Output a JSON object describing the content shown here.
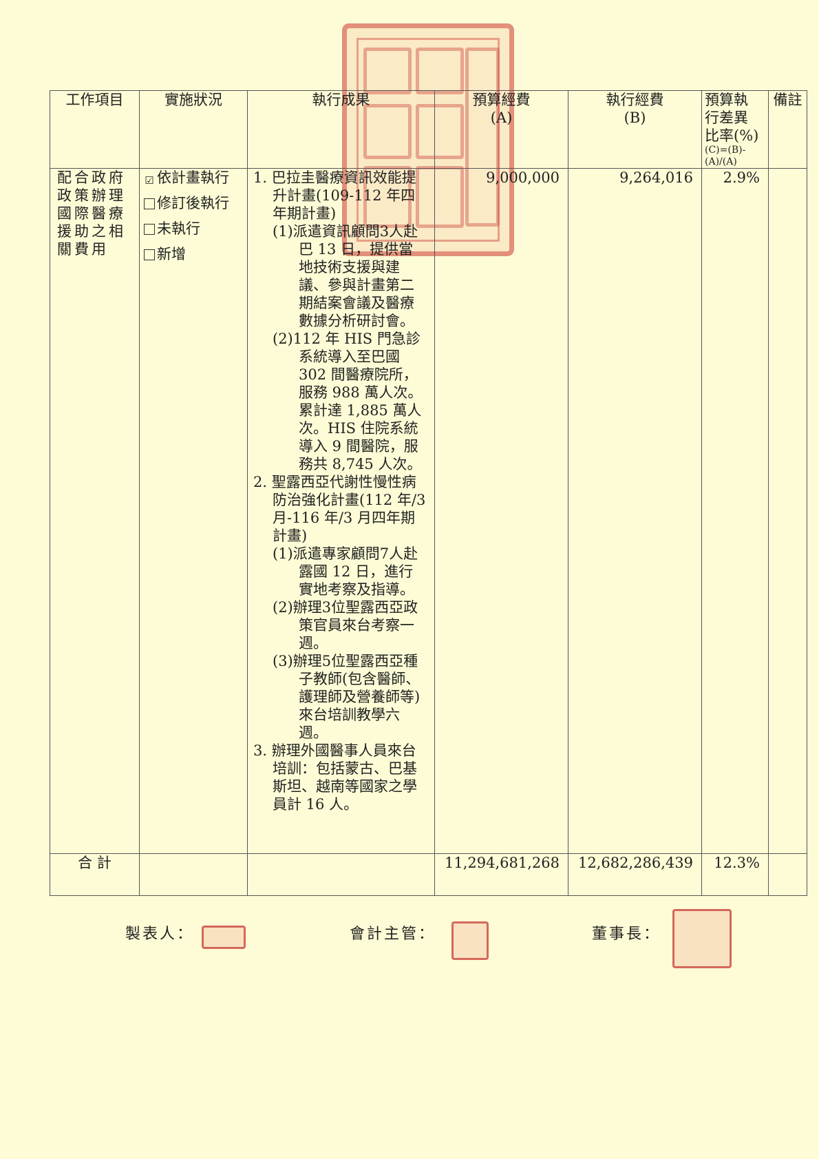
{
  "header": {
    "item": "工作項目",
    "status": "實施狀況",
    "result": "執行成果",
    "budget": "預算經費",
    "budget_sub": "(A)",
    "exec": "執行經費",
    "exec_sub": "(B)",
    "diff_1": "預算執",
    "diff_2": "行差異",
    "diff_3": "比率(%)",
    "diff_4": "(C)=(B)-",
    "diff_5": "(A)/(A)",
    "remarks": "備註"
  },
  "row": {
    "item_lines": [
      "配合政府",
      "政策辦理",
      "國際醫療",
      "援助之相",
      "關費用"
    ],
    "status": [
      {
        "checked": true,
        "label": "依計畫執行"
      },
      {
        "checked": false,
        "label": "修訂後執行"
      },
      {
        "checked": false,
        "label": "未執行"
      },
      {
        "checked": false,
        "label": "新增"
      }
    ],
    "check_mark": "☑",
    "r1": "1. 巴拉圭醫療資訊效能提升計畫(109-112 年四年期計畫)",
    "r1_1": "(1)派遣資訊顧問3人赴巴 13 日，提供當地技術支援與建議、參與計畫第二期結案會議及醫療數據分析研討會。",
    "r1_2": "(2)112 年 HIS 門急診系統導入至巴國 302 間醫療院所，服務 988 萬人次。累計達 1,885 萬人次。HIS 住院系統導入 9 間醫院，服務共 8,745 人次。",
    "r2": "2. 聖露西亞代謝性慢性病防治強化計畫(112 年/3 月-116 年/3 月四年期計畫)",
    "r2_1": "(1)派遣專家顧問7人赴露國 12 日，進行實地考察及指導。",
    "r2_2": "(2)辦理3位聖露西亞政策官員來台考察一週。",
    "r2_3": "(3)辦理5位聖露西亞種子教師(包含醫師、護理師及營養師等)來台培訓教學六週。",
    "r3": "3. 辦理外國醫事人員來台培訓：包括蒙古、巴基斯坦、越南等國家之學員計 16 人。",
    "budget": "9,000,000",
    "exec": "9,264,016",
    "diff": "2.9%"
  },
  "total": {
    "label": "合 計",
    "budget": "11,294,681,268",
    "exec": "12,682,286,439",
    "diff": "12.3%"
  },
  "signatures": {
    "maker": "製表人：",
    "accountant": "會計主管：",
    "chairman": "董事長："
  }
}
